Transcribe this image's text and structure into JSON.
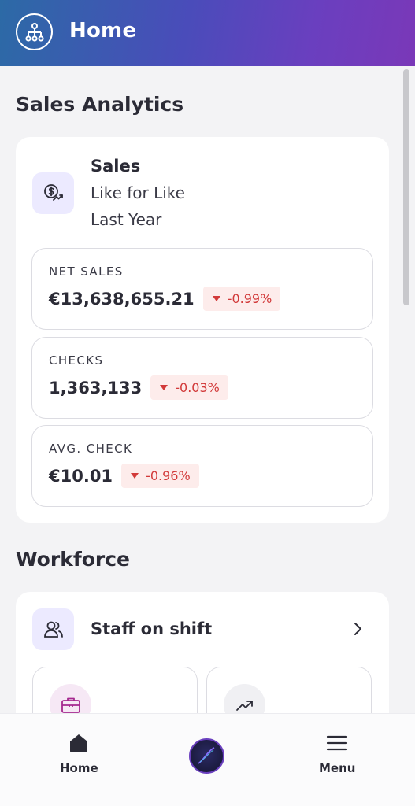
{
  "header": {
    "title": "Home",
    "logo_icon": "org-tree-icon"
  },
  "sales_analytics": {
    "title": "Sales Analytics",
    "card": {
      "icon": "dollar-trend-icon",
      "title": "Sales",
      "subtitle_1": "Like for Like",
      "subtitle_2": "Last Year",
      "metrics": [
        {
          "label": "NET SALES",
          "value": "€13,638,655.21",
          "change": "-0.99%"
        },
        {
          "label": "CHECKS",
          "value": "1,363,133",
          "change": "-0.03%"
        },
        {
          "label": "AVG. CHECK",
          "value": "€10.01",
          "change": "-0.96%"
        }
      ]
    }
  },
  "workforce": {
    "title": "Workforce",
    "staff_label": "Staff on shift",
    "tiles": [
      {
        "icon": "briefcase-icon"
      },
      {
        "icon": "trend-up-icon"
      }
    ]
  },
  "bottom_nav": {
    "home_label": "Home",
    "menu_label": "Menu"
  },
  "colors": {
    "header_start": "#2c6aa6",
    "header_end": "#7a38b8",
    "negative": "#d23a3a",
    "badge_bg": "#fdeceb",
    "icon_tile_bg": "#eceaff"
  }
}
